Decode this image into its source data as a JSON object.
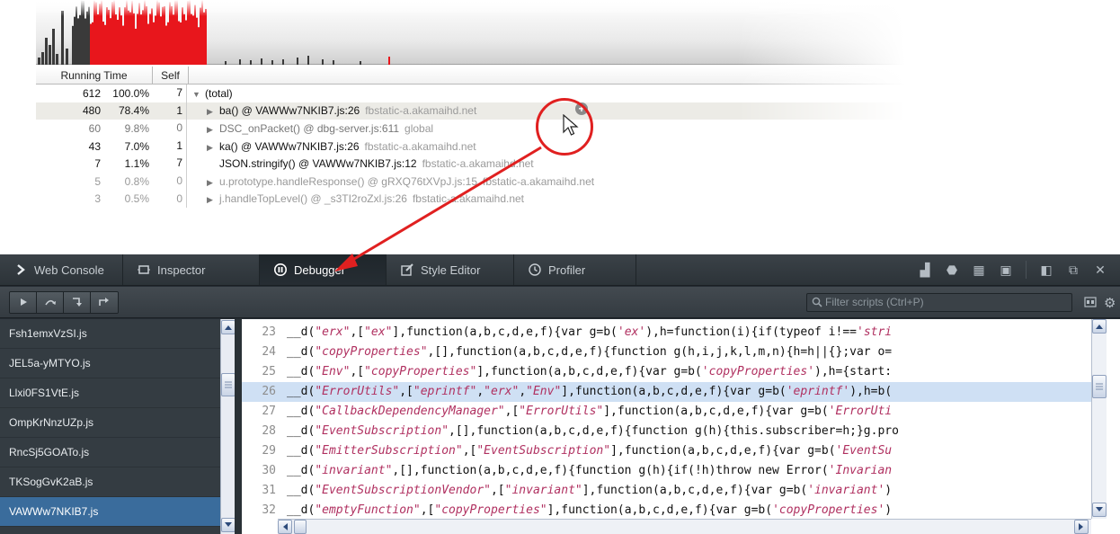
{
  "profiler": {
    "header": {
      "running_time": "Running Time",
      "self": "Self"
    },
    "rows": [
      {
        "num": "612",
        "pct": "100.0%",
        "self": "7",
        "fn": "(total)",
        "src": ""
      },
      {
        "num": "480",
        "pct": "78.4%",
        "self": "1",
        "fn": "ba() @ VAWWw7NKIB7.js:26",
        "src": "fbstatic-a.akamaihd.net"
      },
      {
        "num": "60",
        "pct": "9.8%",
        "self": "0",
        "fn": "DSC_onPacket() @ dbg-server.js:611",
        "src": "global"
      },
      {
        "num": "43",
        "pct": "7.0%",
        "self": "1",
        "fn": "ka() @ VAWWw7NKIB7.js:26",
        "src": "fbstatic-a.akamaihd.net"
      },
      {
        "num": "7",
        "pct": "1.1%",
        "self": "7",
        "fn": "JSON.stringify() @ VAWWw7NKIB7.js:12",
        "src": "fbstatic-a.akamaihd.net"
      },
      {
        "num": "5",
        "pct": "0.8%",
        "self": "0",
        "fn": "u.prototype.handleResponse() @ gRXQ76tXVpJ.js:15",
        "src": "fbstatic-a.akamaihd.net"
      },
      {
        "num": "3",
        "pct": "0.5%",
        "self": "0",
        "fn": "j.handleTopLevel() @ _s3TI2roZxl.js:26",
        "src": "fbstatic-a.akamaihd.net"
      }
    ],
    "colors": {
      "graph_red": "#e8161c",
      "graph_dark": "#3a3a3a",
      "callout": "#e02020"
    }
  },
  "devtools": {
    "tabs": [
      {
        "label": "Web Console",
        "icon": "chevron-right-icon"
      },
      {
        "label": "Inspector",
        "icon": "inspector-box-icon"
      },
      {
        "label": "Debugger",
        "icon": "pause-circle-icon"
      },
      {
        "label": "Style Editor",
        "icon": "pencil-square-icon"
      },
      {
        "label": "Profiler",
        "icon": "clock-icon"
      }
    ],
    "active_tab": "Debugger",
    "filter_placeholder": "Filter scripts (Ctrl+P)",
    "sources": [
      "Fsh1emxVzSI.js",
      "JEL5a-yMTYO.js",
      "Llxi0FS1VtE.js",
      "OmpKrNnzUZp.js",
      "RncSj5GOATo.js",
      "TKSogGvK2aB.js",
      "VAWWw7NKIB7.js"
    ],
    "selected_source": "VAWWw7NKIB7.js",
    "highlight_line": "26",
    "code_lines": [
      {
        "n": "23",
        "text": "__d(\"erx\",[\"ex\"],function(a,b,c,d,e,f){var g=b('ex'),h=function(i){if(typeof i!=='stri"
      },
      {
        "n": "24",
        "text": "__d(\"copyProperties\",[],function(a,b,c,d,e,f){function g(h,i,j,k,l,m,n){h=h||{};var o="
      },
      {
        "n": "25",
        "text": "__d(\"Env\",[\"copyProperties\"],function(a,b,c,d,e,f){var g=b('copyProperties'),h={start:"
      },
      {
        "n": "26",
        "text": "__d(\"ErrorUtils\",[\"eprintf\",\"erx\",\"Env\"],function(a,b,c,d,e,f){var g=b('eprintf'),h=b("
      },
      {
        "n": "27",
        "text": "__d(\"CallbackDependencyManager\",[\"ErrorUtils\"],function(a,b,c,d,e,f){var g=b('ErrorUti"
      },
      {
        "n": "28",
        "text": "__d(\"EventSubscription\",[],function(a,b,c,d,e,f){function g(h){this.subscriber=h;}g.pro"
      },
      {
        "n": "29",
        "text": "__d(\"EmitterSubscription\",[\"EventSubscription\"],function(a,b,c,d,e,f){var g=b('EventSu"
      },
      {
        "n": "30",
        "text": "__d(\"invariant\",[],function(a,b,c,d,e,f){function g(h){if(!h)throw new Error('Invarian"
      },
      {
        "n": "31",
        "text": "__d(\"EventSubscriptionVendor\",[\"invariant\"],function(a,b,c,d,e,f){var g=b('invariant')"
      },
      {
        "n": "32",
        "text": "__d(\"emptyFunction\",[\"copyProperties\"],function(a,b,c,d,e,f){var g=b('copyProperties')"
      }
    ],
    "colors": {
      "toolbar_bg": "#2c3338",
      "selected_source": "#3a6c9c",
      "highlight": "#cfe0f4",
      "string": "#b03060"
    }
  }
}
